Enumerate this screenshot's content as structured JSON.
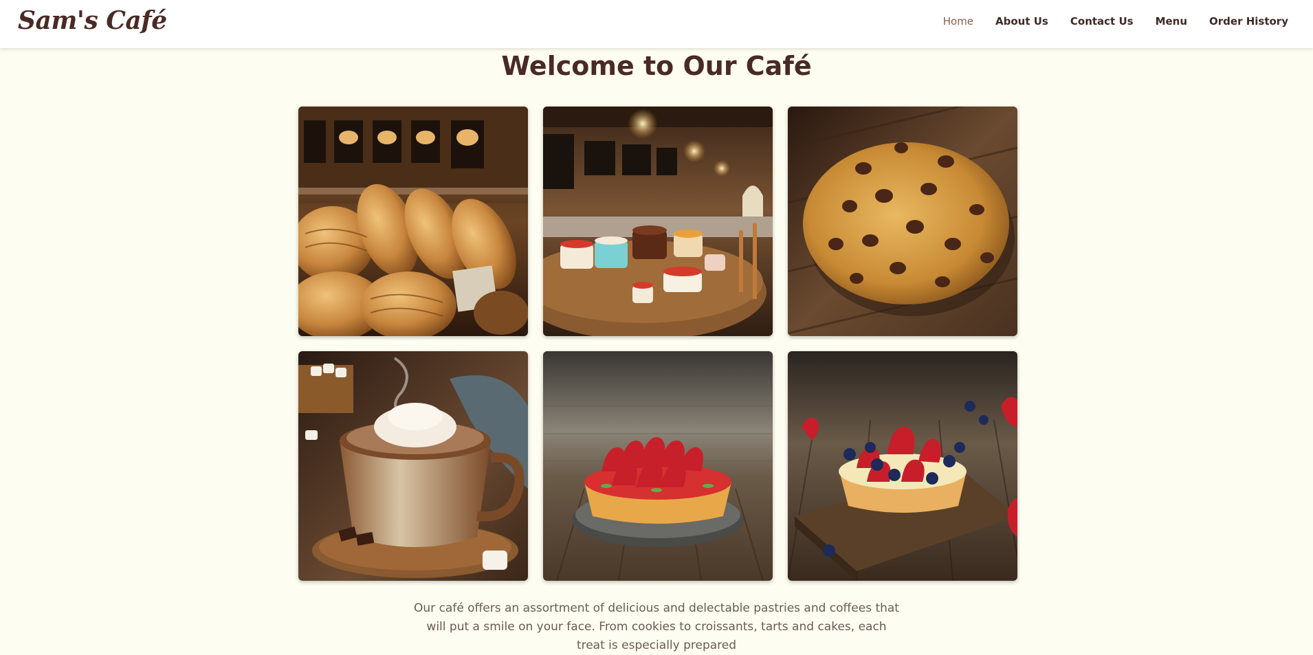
{
  "brand": {
    "name": "Sam's Café"
  },
  "nav": {
    "items": [
      {
        "label": "Home",
        "active": true
      },
      {
        "label": "About Us",
        "active": false
      },
      {
        "label": "Contact Us",
        "active": false
      },
      {
        "label": "Menu",
        "active": false
      },
      {
        "label": "Order History",
        "active": false
      }
    ]
  },
  "main": {
    "title": "Welcome to Our Café",
    "intro": "Our café offers an assortment of delicious and delectable pastries and coffees that will put a smile on your face. From cookies to croissants, tarts and cakes, each treat is especially prepared"
  },
  "gallery": {
    "images": [
      {
        "subject": "bread-bakery"
      },
      {
        "subject": "cake-display-counter"
      },
      {
        "subject": "chocolate-chip-cookie"
      },
      {
        "subject": "hot-chocolate-cup"
      },
      {
        "subject": "strawberry-tart"
      },
      {
        "subject": "mixed-berry-tart"
      }
    ]
  },
  "colors": {
    "page_background": "#fdfdf1",
    "brand_brown": "#4a2a24",
    "nav_active": "#8c5c4a",
    "body_text": "#6a5a55"
  }
}
